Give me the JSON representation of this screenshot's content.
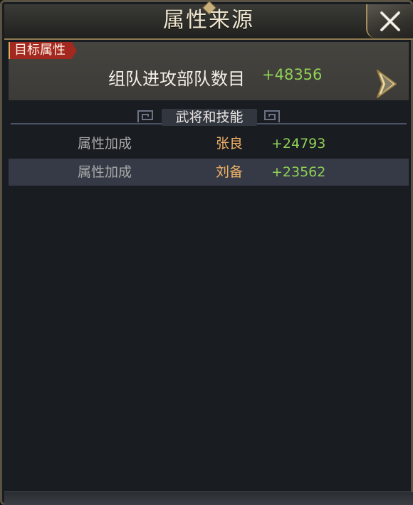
{
  "window": {
    "title": "属性来源",
    "close_icon": "close-x-icon"
  },
  "target": {
    "tag_label": "目标属性",
    "attribute_name": "组队进攻部队数目",
    "attribute_value": "+48356",
    "arrow_icon": "chevron-right-icon"
  },
  "section": {
    "title": "武将和技能"
  },
  "rows": [
    {
      "label": "属性加成",
      "hero": "张良",
      "value": "+24793"
    },
    {
      "label": "属性加成",
      "hero": "刘备",
      "value": "+23562"
    }
  ],
  "colors": {
    "value_green": "#8fd257",
    "hero_orange": "#f0b167",
    "tag_red": "#a3281f",
    "frame_gold": "#8d7a52"
  }
}
